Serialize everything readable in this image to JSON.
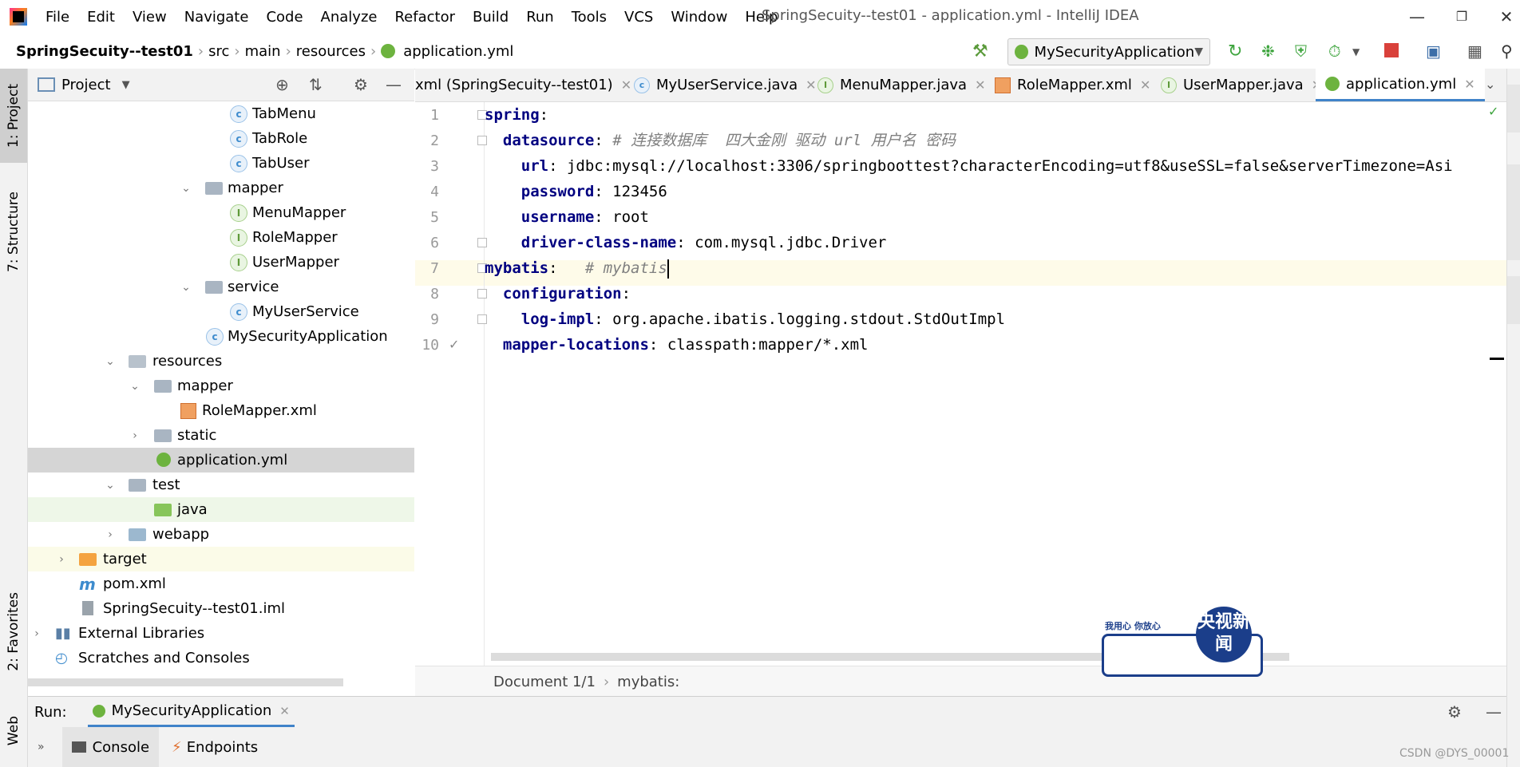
{
  "menu": {
    "items": [
      "File",
      "Edit",
      "View",
      "Navigate",
      "Code",
      "Analyze",
      "Refactor",
      "Build",
      "Run",
      "Tools",
      "VCS",
      "Window",
      "Help"
    ],
    "window_title": "SpringSecuity--test01 - application.yml - IntelliJ IDEA"
  },
  "nav": {
    "project": "SpringSecuity--test01",
    "crumbs": [
      "src",
      "main",
      "resources",
      "application.yml"
    ],
    "run_config": "MySecurityApplication"
  },
  "left_strip": {
    "project_tab": "1: Project",
    "structure_tab": "7: Structure",
    "favorites_tab": "2: Favorites",
    "web_tab": "Web"
  },
  "project_panel": {
    "title": "Project",
    "tree": [
      {
        "label": "TabMenu",
        "kind": "class"
      },
      {
        "label": "TabRole",
        "kind": "class"
      },
      {
        "label": "TabUser",
        "kind": "class"
      },
      {
        "label": "mapper",
        "kind": "package"
      },
      {
        "label": "MenuMapper",
        "kind": "interface"
      },
      {
        "label": "RoleMapper",
        "kind": "interface"
      },
      {
        "label": "UserMapper",
        "kind": "interface"
      },
      {
        "label": "service",
        "kind": "package"
      },
      {
        "label": "MyUserService",
        "kind": "class"
      },
      {
        "label": "MySecurityApplication",
        "kind": "spring"
      },
      {
        "label": "resources",
        "kind": "resfolder"
      },
      {
        "label": "mapper",
        "kind": "folder"
      },
      {
        "label": "RoleMapper.xml",
        "kind": "xml"
      },
      {
        "label": "static",
        "kind": "folder"
      },
      {
        "label": "application.yml",
        "kind": "yml"
      },
      {
        "label": "test",
        "kind": "folder"
      },
      {
        "label": "java",
        "kind": "testfolder"
      },
      {
        "label": "webapp",
        "kind": "webfolder"
      },
      {
        "label": "target",
        "kind": "targetfolder"
      },
      {
        "label": "pom.xml",
        "kind": "maven"
      },
      {
        "label": "SpringSecuity--test01.iml",
        "kind": "iml"
      },
      {
        "label": "External Libraries",
        "kind": "libs"
      },
      {
        "label": "Scratches and Consoles",
        "kind": "scratch"
      }
    ]
  },
  "editor_tabs": [
    {
      "label": "xml (SpringSecuity--test01)",
      "kind": "none"
    },
    {
      "label": "MyUserService.java",
      "kind": "class"
    },
    {
      "label": "MenuMapper.java",
      "kind": "interface"
    },
    {
      "label": "RoleMapper.xml",
      "kind": "xml"
    },
    {
      "label": "UserMapper.java",
      "kind": "interface"
    },
    {
      "label": "application.yml",
      "kind": "yml"
    }
  ],
  "code": {
    "line_numbers": [
      "1",
      "2",
      "3",
      "4",
      "5",
      "6",
      "7",
      "8",
      "9",
      "10"
    ],
    "lines": [
      {
        "indent": "",
        "key": "spring",
        "sep": ":",
        "value": "",
        "comment": ""
      },
      {
        "indent": "  ",
        "key": "datasource",
        "sep": ":",
        "value": " ",
        "comment": "# 连接数据库  四大金刚 驱动 url 用户名 密码"
      },
      {
        "indent": "    ",
        "key": "url",
        "sep": ":",
        "value": " jdbc:mysql://localhost:3306/springboottest?characterEncoding=utf8&useSSL=false&serverTimezone=Asi",
        "comment": ""
      },
      {
        "indent": "    ",
        "key": "password",
        "sep": ":",
        "value": " 123456",
        "comment": ""
      },
      {
        "indent": "    ",
        "key": "username",
        "sep": ":",
        "value": " root",
        "comment": ""
      },
      {
        "indent": "    ",
        "key": "driver-class-name",
        "sep": ":",
        "value": " com.mysql.jdbc.Driver",
        "comment": ""
      },
      {
        "indent": "",
        "key": "mybatis",
        "sep": ":",
        "value": "   ",
        "comment": "# mybatis"
      },
      {
        "indent": "  ",
        "key": "configuration",
        "sep": ":",
        "value": "",
        "comment": ""
      },
      {
        "indent": "    ",
        "key": "log-impl",
        "sep": ":",
        "value": " org.apache.ibatis.logging.stdout.StdOutImpl",
        "comment": ""
      },
      {
        "indent": "  ",
        "key": "mapper-locations",
        "sep": ":",
        "value": " classpath:mapper/*.xml",
        "comment": ""
      }
    ]
  },
  "editor_breadcrumb": {
    "doc": "Document 1/1",
    "path": "mybatis:"
  },
  "run_panel": {
    "label": "Run:",
    "config": "MySecurityApplication",
    "console_tab": "Console",
    "endpoints_tab": "Endpoints"
  },
  "stamp": {
    "slogan": "我用心 你放心",
    "brand": "央视新闻"
  },
  "watermark": "CSDN @DYS_00001",
  "colors": {
    "key": "#000080",
    "comment": "#808080",
    "active_tab_underline": "#4083c9",
    "current_line": "#fefbe9"
  }
}
